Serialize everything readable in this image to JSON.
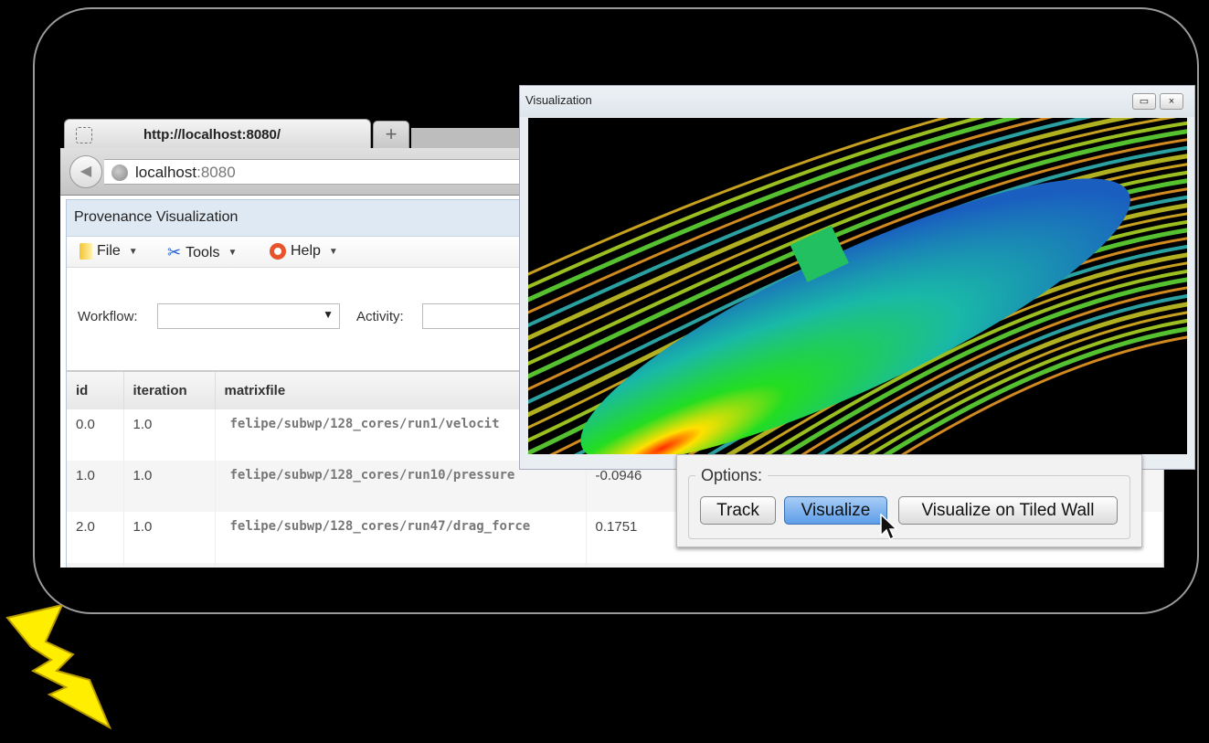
{
  "browser": {
    "tab_title": "http://localhost:8080/",
    "new_tab_label": "+",
    "url_host": "localhost",
    "url_port": ":8080"
  },
  "app": {
    "title": "Provenance Visualization",
    "menu": [
      {
        "label": "File",
        "icon": "folder-icon"
      },
      {
        "label": "Tools",
        "icon": "tools-icon"
      },
      {
        "label": "Help",
        "icon": "lifebuoy-icon"
      }
    ],
    "form": {
      "workflow_label": "Workflow:",
      "workflow_value": "",
      "activity_label": "Activity:",
      "activity_value": ""
    },
    "table": {
      "columns": [
        "id",
        "iteration",
        "matrixfile",
        ""
      ],
      "rows": [
        [
          "0.0",
          "1.0",
          "felipe/subwp/128_cores/run1/velocit",
          ""
        ],
        [
          "1.0",
          "1.0",
          "felipe/subwp/128_cores/run10/pressure",
          "-0.0946"
        ],
        [
          "2.0",
          "1.0",
          "felipe/subwp/128_cores/run47/drag_force",
          "0.1751"
        ],
        [
          "",
          "",
          "",
          ""
        ]
      ]
    }
  },
  "viz_window": {
    "title": "Visualization",
    "maximize": "▭",
    "close": "×"
  },
  "options": {
    "legend": "Options:",
    "buttons": [
      "Track",
      "Visualize",
      "Visualize on Tiled Wall"
    ],
    "active": "Visualize"
  },
  "colors": {
    "accent": "#5d9ee8",
    "bolt": "#ffee00",
    "header": "#dfe9f3"
  }
}
